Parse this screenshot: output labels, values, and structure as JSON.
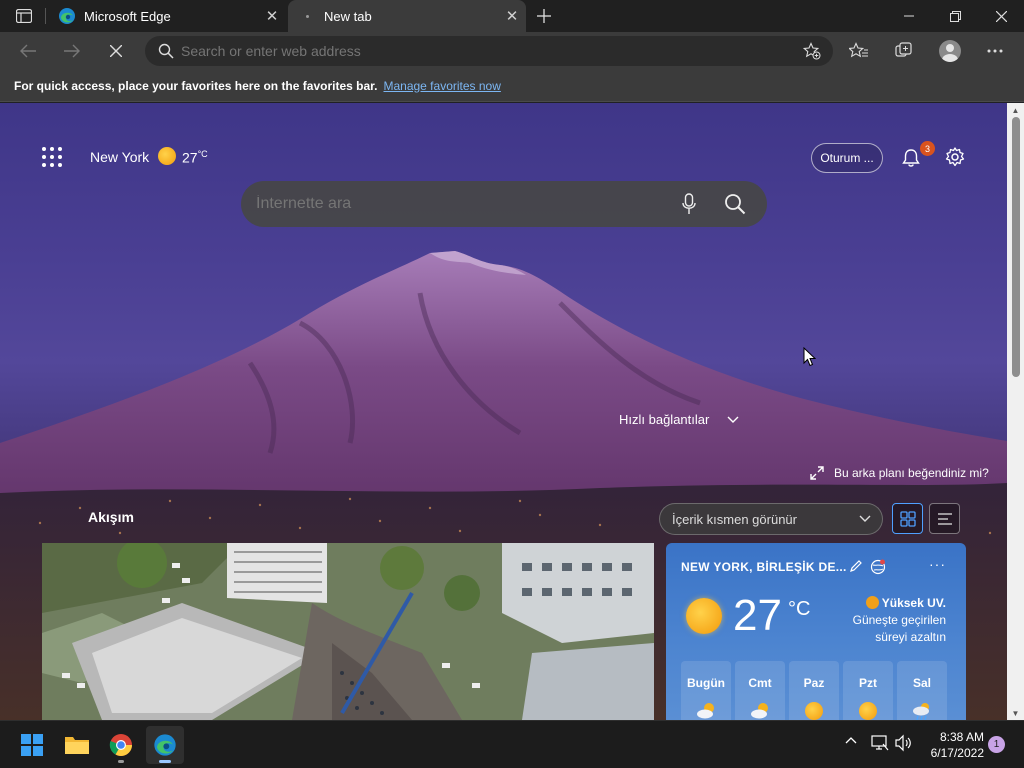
{
  "browser": {
    "tabs": [
      {
        "title": "Microsoft Edge",
        "active": false
      },
      {
        "title": "New tab",
        "active": true
      }
    ],
    "address_placeholder": "Search or enter web address",
    "favorites_bar": {
      "message": "For quick access, place your favorites here on the favorites bar.",
      "link": "Manage favorites now"
    }
  },
  "newtab": {
    "location": "New York",
    "temperature": "27",
    "temp_unit": "°C",
    "signin_label": "Oturum ...",
    "notification_count": "3",
    "search_placeholder": "İnternette ara",
    "quick_links_label": "Hızlı bağlantılar",
    "like_background_label": "Bu arka planı beğendiniz mi?",
    "feed_title": "Akışım",
    "visibility_select": "İçerik kısmen görünür"
  },
  "weather_card": {
    "title": "NEW YORK, BİRLEŞİK DE...",
    "temperature": "27",
    "unit": "°C",
    "alert_title": "Yüksek UV.",
    "alert_text": "Güneşte geçirilen süreyi azaltın",
    "forecast": [
      {
        "day": "Bugün",
        "icon": "partly-cloudy-icon"
      },
      {
        "day": "Cmt",
        "icon": "partly-cloudy-icon"
      },
      {
        "day": "Paz",
        "icon": "sunny-icon"
      },
      {
        "day": "Pzt",
        "icon": "sunny-icon"
      },
      {
        "day": "Sal",
        "icon": "rain-icon"
      }
    ]
  },
  "taskbar": {
    "time": "8:38 AM",
    "date": "6/17/2022",
    "notification_count": "1"
  },
  "colors": {
    "accent_link": "#7cb6f2",
    "notification_badge": "#d9531e",
    "weather_card": "#3a73c6"
  }
}
